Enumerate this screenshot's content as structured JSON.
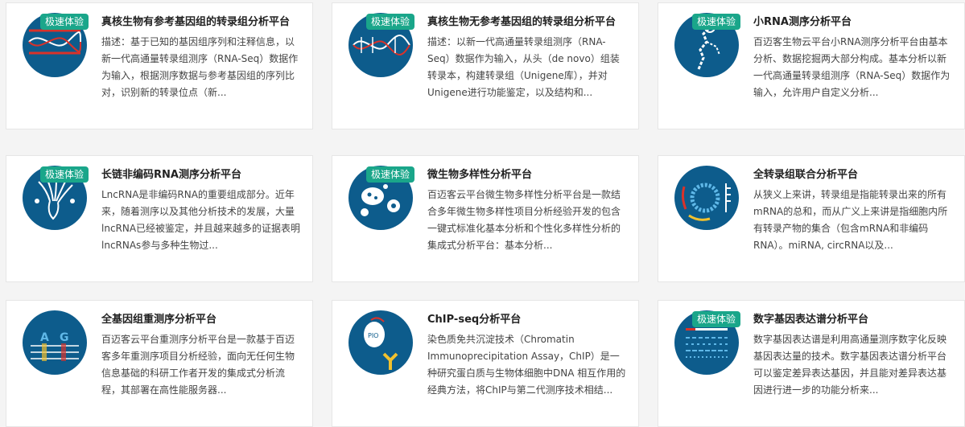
{
  "badge_label": "极速体验",
  "colors": {
    "icon_bg": "#0d5c8c",
    "badge_bg": "#1aa68a",
    "accent_red": "#d9322a"
  },
  "cards": [
    {
      "icon": "dna-helix-icon",
      "has_badge": true,
      "title": "真核生物有参考基因组的转录组分析平台",
      "desc": "描述：基于已知的基因组序列和注释信息，以新一代高通量转录组测序（RNA-Seq）数据作为输入，根据测序数据与参考基因组的序列比对，识别新的转录位点（新..."
    },
    {
      "icon": "dna-helix-icon",
      "has_badge": true,
      "title": "真核生物无参考基因组的转录组分析平台",
      "desc": "描述：以新一代高通量转录组测序（RNA-Seq）数据作为输入，从头（de novo）组装转录本，构建转录组（Unigene库），并对Unigene进行功能鉴定，以及结构和..."
    },
    {
      "icon": "small-rna-icon",
      "has_badge": true,
      "title": "小RNA测序分析平台",
      "desc": "百迈客生物云平台小RNA测序分析平台由基本分析、数据挖掘两大部分构成。基本分析以新一代高通量转录组测序（RNA-Seq）数据作为输入，允许用户自定义分析..."
    },
    {
      "icon": "lncrna-icon",
      "has_badge": true,
      "title": "长链非编码RNA测序分析平台",
      "desc": "LncRNA是非编码RNA的重要组成部分。近年来，随着测序以及其他分析技术的发展，大量lncRNA已经被鉴定，并且越来越多的证据表明lncRNAs参与多种生物过..."
    },
    {
      "icon": "microbe-icon",
      "has_badge": true,
      "title": "微生物多样性分析平台",
      "desc": "百迈客云平台微生物多样性分析平台是一款结合多年微生物多样性项目分析经验开发的包含一键式标准化基本分析和个性化多样性分析的集成式分析平台：基本分析..."
    },
    {
      "icon": "circular-rna-icon",
      "has_badge": false,
      "title": "全转录组联合分析平台",
      "desc": "从狭义上来讲，转录组是指能转录出来的所有mRNA的总和，而从广义上来讲是指细胞内所有转录产物的集合（包含mRNA和非编码RNA）。miRNA, circRNA以及..."
    },
    {
      "icon": "genome-resequencing-icon",
      "has_badge": false,
      "title": "全基因组重测序分析平台",
      "desc": "百迈客云平台重测序分析平台是一款基于百迈客多年重测序项目分析经验，面向无任何生物信息基础的科研工作者开发的集成式分析流程，其部署在高性能服务器..."
    },
    {
      "icon": "chip-seq-icon",
      "has_badge": false,
      "title": "ChIP-seq分析平台",
      "desc": "染色质免共沉淀技术（Chromatin Immunoprecipitation Assay，ChIP）是一种研究蛋白质与生物体细胞中DNA 相互作用的经典方法，将ChIP与第二代测序技术相结..."
    },
    {
      "icon": "digital-expression-icon",
      "has_badge": true,
      "title": "数字基因表达谱分析平台",
      "desc": "数字基因表达谱是利用高通量测序数字化反映基因表达量的技术。数字基因表达谱分析平台可以鉴定差异表达基因，并且能对差异表达基因进行进一步的功能分析来..."
    }
  ]
}
